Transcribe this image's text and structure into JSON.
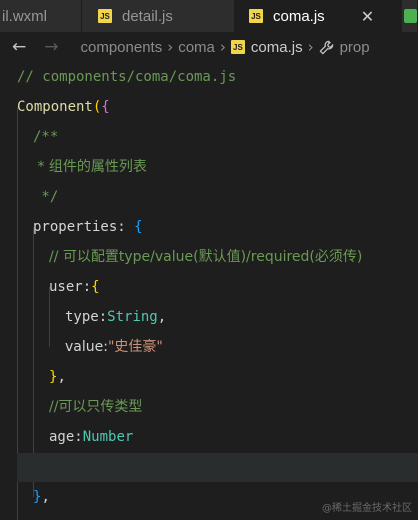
{
  "tabs": [
    {
      "label": "il.wxml",
      "active": false
    },
    {
      "label": "detail.js",
      "icon": "JS",
      "active": false
    },
    {
      "label": "coma.js",
      "icon": "JS",
      "active": true,
      "close": "✕"
    }
  ],
  "breadcrumb": {
    "back": "←",
    "forward": "→",
    "items": [
      "components",
      "coma",
      "coma.js",
      "prop"
    ],
    "js_icon": "JS"
  },
  "code": {
    "l1": "// components/coma/coma.js",
    "l2_fn": "Component",
    "l2_paren": "(",
    "l2_brace": "{",
    "l3": "/**",
    "l4": " * 组件的属性列表",
    "l5": " */",
    "l6_key": "properties",
    "l6_colon": ": ",
    "l6_brace": "{",
    "l7": "// 可以配置type/value(默认值)/required(必须传)",
    "l8_key": "user",
    "l8_colon": ":",
    "l8_brace": "{",
    "l9_key": "type",
    "l9_colon": ":",
    "l9_val": "String",
    "l9_comma": ",",
    "l10_key": "value",
    "l10_colon": ":",
    "l10_val": "\"史佳豪\"",
    "l11_brace": "}",
    "l11_comma": ",",
    "l12": "//可以只传类型",
    "l13_key": "age",
    "l13_colon": ":",
    "l13_val": "Number",
    "l15_brace": "}",
    "l15_comma": ","
  },
  "watermark": "@稀土掘金技术社区",
  "colors": {
    "background": "#1e1e1e",
    "comment": "#6a9955",
    "function": "#dcdcaa",
    "type": "#4ec9b0",
    "string": "#ce9178",
    "bracket_gold": "#ffd700",
    "bracket_purple": "#da70d6",
    "bracket_blue": "#179fff"
  }
}
